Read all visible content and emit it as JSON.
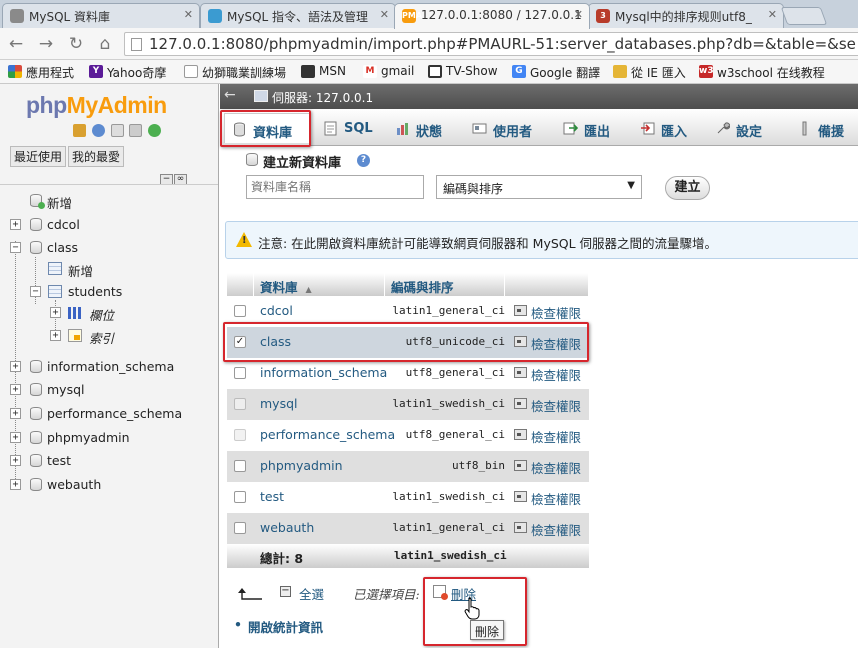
{
  "browser": {
    "tabs": [
      {
        "title": "MySQL 資料庫",
        "icon_color": "#8a8a8a"
      },
      {
        "title": "MySQL 指令、語法及管理",
        "icon_color": "#3b9bd1"
      },
      {
        "title": "127.0.0.1:8080 / 127.0.0.1",
        "icon_color": "#f89c0e",
        "icon_text": "PMA"
      },
      {
        "title": "Mysql中的排序规则utf8_",
        "icon_color": "#b83c2b",
        "icon_text": "3"
      }
    ],
    "url": "127.0.0.1:8080/phpmyadmin/import.php#PMAURL-51:server_databases.php?db=&table=&se",
    "bookmarks": [
      {
        "label": "應用程式",
        "icon": "apps-icon",
        "color": "#d84b3d"
      },
      {
        "label": "Yahoo奇摩",
        "icon": "yahoo-icon",
        "color": "#5b1b98",
        "icon_text": "Y"
      },
      {
        "label": "幼獅職業訓練場",
        "icon": "page-icon",
        "color": "#bbbbbb"
      },
      {
        "label": "MSN",
        "icon": "msn-icon",
        "color": "#333333"
      },
      {
        "label": "gmail",
        "icon": "gmail-icon",
        "color": "#d93025",
        "icon_text": "M"
      },
      {
        "label": "TV-Show",
        "icon": "tv-icon",
        "color": "#333333"
      },
      {
        "label": "Google 翻譯",
        "icon": "translate-icon",
        "color": "#4285f4",
        "icon_text": "G"
      },
      {
        "label": "從 IE 匯入",
        "icon": "folder-icon",
        "color": "#e5b536"
      },
      {
        "label": "w3school 在线教程",
        "icon": "w3school-icon",
        "color": "#c62828",
        "icon_text": "w3"
      }
    ]
  },
  "sidebar": {
    "logo_php": "php",
    "logo_my": "MyAdmin",
    "tabs": [
      "最近使用",
      "我的最愛"
    ],
    "tree": [
      {
        "label": "新增",
        "type": "new"
      },
      {
        "label": "cdcol",
        "type": "db"
      },
      {
        "label": "class",
        "type": "db",
        "expanded": true
      },
      {
        "label": "新增",
        "type": "new",
        "level": 1
      },
      {
        "label": "students",
        "type": "table",
        "level": 1,
        "expanded": true
      },
      {
        "label": "欄位",
        "type": "columns",
        "level": 2
      },
      {
        "label": "索引",
        "type": "indexes",
        "level": 2
      },
      {
        "label": "information_schema",
        "type": "db"
      },
      {
        "label": "mysql",
        "type": "db"
      },
      {
        "label": "performance_schema",
        "type": "db"
      },
      {
        "label": "phpmyadmin",
        "type": "db"
      },
      {
        "label": "test",
        "type": "db"
      },
      {
        "label": "webauth",
        "type": "db"
      }
    ]
  },
  "main": {
    "server_label": "伺服器: 127.0.0.1",
    "menu": [
      {
        "label": "資料庫",
        "icon": "database-icon",
        "active": true
      },
      {
        "label": "SQL",
        "icon": "sql-icon"
      },
      {
        "label": "狀態",
        "icon": "status-icon"
      },
      {
        "label": "使用者",
        "icon": "users-icon"
      },
      {
        "label": "匯出",
        "icon": "export-icon"
      },
      {
        "label": "匯入",
        "icon": "import-icon"
      },
      {
        "label": "設定",
        "icon": "settings-icon"
      },
      {
        "label": "備援",
        "icon": "replication-icon"
      }
    ],
    "create": {
      "title": "建立新資料庫",
      "name_placeholder": "資料庫名稱",
      "collation_selected": "編碼與排序",
      "button": "建立"
    },
    "notice": "注意: 在此開啟資料庫統計可能導致網頁伺服器和 MySQL 伺服器之間的流量驟增。",
    "table": {
      "headers": [
        "資料庫",
        "編碼與排序"
      ],
      "rows": [
        {
          "name": "cdcol",
          "collation": "latin1_general_ci",
          "checked": false
        },
        {
          "name": "class",
          "collation": "utf8_unicode_ci",
          "checked": true
        },
        {
          "name": "information_schema",
          "collation": "utf8_general_ci",
          "checked": false
        },
        {
          "name": "mysql",
          "collation": "latin1_swedish_ci",
          "checked": false
        },
        {
          "name": "performance_schema",
          "collation": "utf8_general_ci",
          "checked": false
        },
        {
          "name": "phpmyadmin",
          "collation": "utf8_bin",
          "checked": false
        },
        {
          "name": "test",
          "collation": "latin1_swedish_ci",
          "checked": false
        },
        {
          "name": "webauth",
          "collation": "latin1_general_ci",
          "checked": false
        }
      ],
      "priv_label": "檢查權限",
      "total_label": "總計: 8",
      "total_collation": "latin1_swedish_ci"
    },
    "footer": {
      "select_all": "全選",
      "with_selected": "已選擇項目:",
      "drop": "刪除",
      "tooltip": "刪除",
      "stats_link": "開啟統計資訊"
    }
  },
  "colors": {
    "link": "#235a81",
    "highlight": "#d6262d",
    "logo_php": "#6c78af",
    "logo_my": "#f89c0e"
  }
}
